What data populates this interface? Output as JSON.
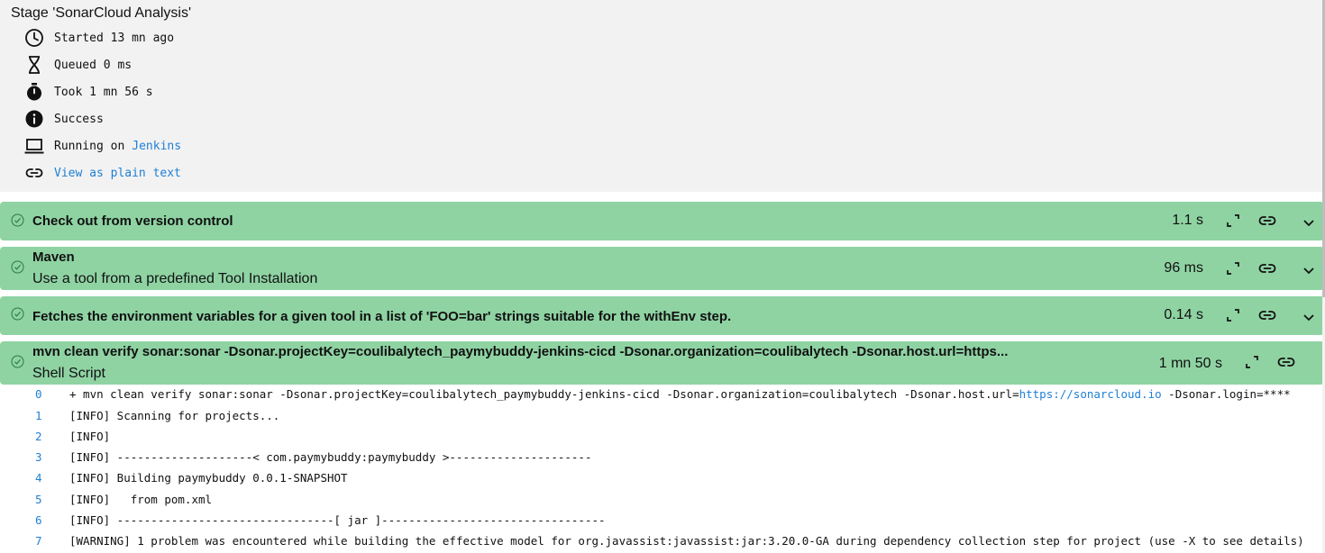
{
  "stage": {
    "title": "Stage 'SonarCloud Analysis'",
    "started": "Started 13 mn ago",
    "queued": "Queued 0 ms",
    "took": "Took 1 mn 56 s",
    "status": "Success",
    "running_prefix": "Running on",
    "running_node": "Jenkins",
    "plain_text_link": "View as plain text"
  },
  "steps": [
    {
      "title": "Check out from version control",
      "subtitle": "",
      "duration": "1.1 s",
      "status": "success"
    },
    {
      "title": "Maven",
      "subtitle": "Use a tool from a predefined Tool Installation",
      "duration": "96 ms",
      "status": "success"
    },
    {
      "title": "Fetches the environment variables for a given tool in a list of 'FOO=bar' strings suitable for the withEnv step.",
      "subtitle": "",
      "duration": "0.14 s",
      "status": "success"
    },
    {
      "title": "mvn clean verify sonar:sonar -Dsonar.projectKey=coulibalytech_paymybuddy-jenkins-cicd -Dsonar.organization=coulibalytech -Dsonar.host.url=https...",
      "subtitle": "Shell Script",
      "duration": "1 mn 50 s",
      "status": "success"
    }
  ],
  "log": {
    "line0_pre": "+ mvn clean verify sonar:sonar -Dsonar.projectKey=coulibalytech_paymybuddy-jenkins-cicd -Dsonar.organization=coulibalytech -Dsonar.host.url=",
    "line0_link": "https://sonarcloud.io",
    "line0_post": " -Dsonar.login=****",
    "lines": [
      {
        "num": "0",
        "text": ""
      },
      {
        "num": "1",
        "text": "[INFO] Scanning for projects..."
      },
      {
        "num": "2",
        "text": "[INFO]"
      },
      {
        "num": "3",
        "text": "[INFO] --------------------< com.paymybuddy:paymybuddy >---------------------"
      },
      {
        "num": "4",
        "text": "[INFO] Building paymybuddy 0.0.1-SNAPSHOT"
      },
      {
        "num": "5",
        "text": "[INFO]   from pom.xml"
      },
      {
        "num": "6",
        "text": "[INFO] --------------------------------[ jar ]---------------------------------"
      },
      {
        "num": "7",
        "text": "[WARNING] 1 problem was encountered while building the effective model for org.javassist:javassist:jar:3.20.0-GA during dependency collection step for project (use -X to see details)"
      }
    ]
  },
  "colors": {
    "step_bg": "#8fd3a3",
    "link": "#1f7fd4",
    "panel_bg": "#f2f2f2"
  }
}
